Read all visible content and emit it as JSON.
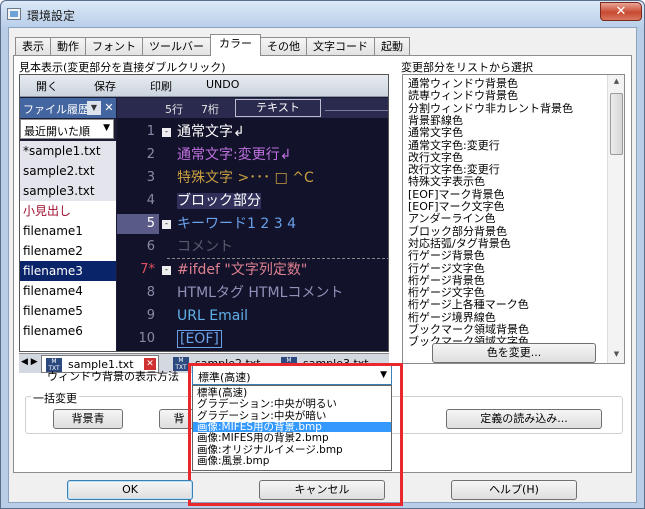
{
  "window": {
    "title": "環境設定",
    "close_glyph": "✕"
  },
  "tabs": [
    {
      "label": "表示",
      "active": false
    },
    {
      "label": "動作",
      "active": false
    },
    {
      "label": "フォント",
      "active": false
    },
    {
      "label": "ツールバー",
      "active": false
    },
    {
      "label": "カラー",
      "active": true
    },
    {
      "label": "その他",
      "active": false
    },
    {
      "label": "文字コード",
      "active": false
    },
    {
      "label": "起動",
      "active": false
    }
  ],
  "preview_label": "見本表示(変更部分を直接ダブルクリック)",
  "parts_label": "変更部分をリストから選択",
  "preview": {
    "toolbar": [
      "開く",
      "保存",
      "印刷",
      "UNDO"
    ],
    "file_history_label": "ファイル履歴",
    "file_history_close": "✕",
    "sort_value": "最近開いた順",
    "files": [
      {
        "name": "*sample1.txt",
        "style": "gray"
      },
      {
        "name": "sample2.txt",
        "style": "gray"
      },
      {
        "name": "sample3.txt",
        "style": "gray"
      },
      {
        "name": "小見出し",
        "style": "red"
      },
      {
        "name": "filename1",
        "style": "plain"
      },
      {
        "name": "filename2",
        "style": "plain"
      },
      {
        "name": "filename3",
        "style": "sel"
      },
      {
        "name": "filename4",
        "style": "plain"
      },
      {
        "name": "filename5",
        "style": "plain"
      },
      {
        "name": "filename6",
        "style": "plain"
      }
    ],
    "ruler": {
      "line": "5行",
      "col": "7桁",
      "mode": "テキスト"
    },
    "lines": [
      {
        "num": "1",
        "fold": "-",
        "text": "通常文字↲",
        "cls": "c-normal",
        "current": false
      },
      {
        "num": "2",
        "fold": "",
        "text": "通常文字:変更行↲",
        "cls": "c-mod",
        "current": false
      },
      {
        "num": "3",
        "fold": "",
        "text": "特殊文字 >･･･ □ ^C",
        "cls": "c-special",
        "current": false
      },
      {
        "num": "4",
        "fold": "",
        "text": "ブロック部分",
        "cls": "c-block",
        "current": false
      },
      {
        "num": "5",
        "fold": "-",
        "text": "キーワード1 2 3 4",
        "cls": "c-kw",
        "current": true
      },
      {
        "num": "6",
        "fold": "",
        "text": "コメント",
        "cls": "c-comment",
        "current": false
      },
      {
        "num": "7*",
        "fold": "-",
        "text": "#ifdef \"文字列定数\"",
        "cls": "c-ifdef",
        "current": false
      },
      {
        "num": "8",
        "fold": "",
        "text": "HTMLタグ HTMLコメント",
        "cls": "c-html",
        "current": false
      },
      {
        "num": "9",
        "fold": "",
        "text": "URL Email",
        "cls": "c-url",
        "current": false
      },
      {
        "num": "10",
        "fold": "",
        "text": "[EOF]",
        "cls": "c-eof",
        "current": false
      }
    ],
    "file_tabs": [
      {
        "name": "sample1.txt",
        "active": true,
        "icon": "M TXT"
      },
      {
        "name": "sample2.txt",
        "active": false,
        "icon": "M TXT"
      },
      {
        "name": "sample3.txt",
        "active": false,
        "icon": "M TXT"
      }
    ],
    "tab_close": "✕",
    "nav_arrows": "◀ ▶"
  },
  "parts": [
    "通常ウィンドウ背景色",
    "読専ウィンドウ背景色",
    "分割ウィンドウ非カレント背景色",
    "背景罫線色",
    "通常文字色",
    "通常文字色:変更行",
    "改行文字色",
    "改行文字色:変更行",
    "特殊文字表示色",
    "[EOF]マーク背景色",
    "[EOF]マーク文字色",
    "アンダーライン色",
    "ブロック部分背景色",
    "対応括弧/タグ背景色",
    "行ゲージ背景色",
    "行ゲージ文字色",
    "桁ゲージ背景色",
    "桁ゲージ文字色",
    "桁ゲージ上各種マーク色",
    "桁ゲージ境界線色",
    "ブックマーク領域背景色",
    "ブックマーク領域文字色"
  ],
  "change_color_button": "色を変更...",
  "bg_display_label": "ウィンドウ背景の表示方法",
  "bg_display_value": "標準(高速)",
  "bg_options": [
    {
      "label": "標準(高速)",
      "highlighted": false
    },
    {
      "label": "グラデーション:中央が明るい",
      "highlighted": false
    },
    {
      "label": "グラデーション:中央が暗い",
      "highlighted": false
    },
    {
      "label": "画像:MIFES用の背景.bmp",
      "highlighted": true
    },
    {
      "label": "画像:MIFES用の背景2.bmp",
      "highlighted": false
    },
    {
      "label": "画像:オリジナルイメージ.bmp",
      "highlighted": false
    },
    {
      "label": "画像:風景.bmp",
      "highlighted": false
    }
  ],
  "bulk_change_label": "一括変更",
  "bulk_buttons": [
    "背景青",
    "背"
  ],
  "load_definitions_button": "定義の読み込み...",
  "footer": {
    "ok": "OK",
    "cancel": "キャンセル",
    "help": "ヘルプ(H)"
  },
  "colors": {
    "highlight_frame": "#e8282c",
    "selection": "#3399ff",
    "editor_bg": "#12122a"
  }
}
